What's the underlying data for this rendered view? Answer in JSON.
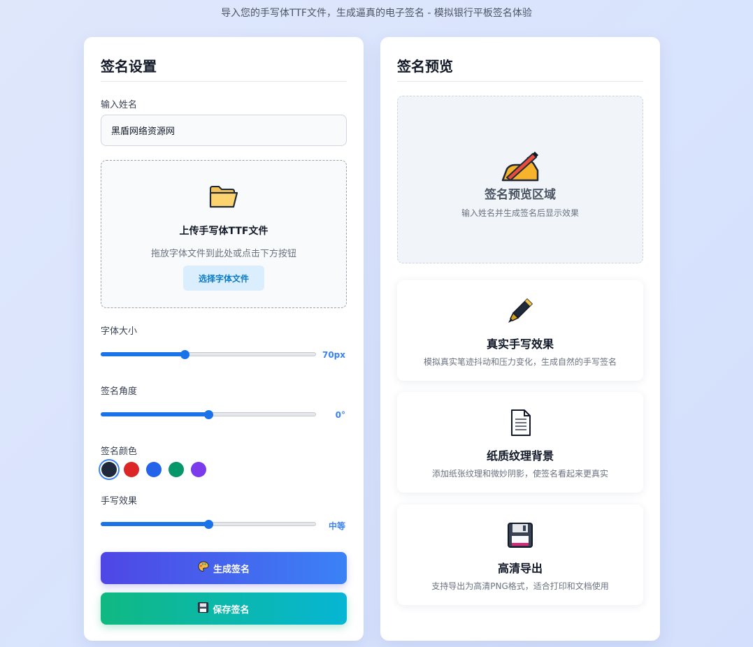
{
  "header": {
    "subtitle": "导入您的手写体TTF文件，生成逼真的电子签名 - 模拟银行平板签名体验"
  },
  "settings": {
    "title": "签名设置",
    "name_label": "输入姓名",
    "name_value": "黑盾网络资源网",
    "upload": {
      "title": "上传手写体TTF文件",
      "hint": "拖放字体文件到此处或点击下方按钮",
      "button": "选择字体文件"
    },
    "font_size": {
      "label": "字体大小",
      "value_text": "70px",
      "level": 0.39
    },
    "angle": {
      "label": "签名角度",
      "value_text": "0°",
      "level": 0.5
    },
    "color": {
      "label": "签名颜色",
      "options": [
        "#1e293b",
        "#dc2626",
        "#2563eb",
        "#059669",
        "#7c3aed"
      ],
      "selected_index": 0
    },
    "effect": {
      "label": "手写效果",
      "value_text": "中等",
      "level": 0.5
    },
    "generate_button": "生成签名",
    "save_button": "保存签名"
  },
  "preview": {
    "title": "签名预览",
    "area_title": "签名预览区域",
    "area_hint": "输入姓名并生成签名后显示效果",
    "features": [
      {
        "icon": "fountain-pen-icon",
        "title": "真实手写效果",
        "desc": "模拟真实笔迹抖动和压力变化，生成自然的手写签名"
      },
      {
        "icon": "document-icon",
        "title": "纸质纹理背景",
        "desc": "添加纸张纹理和微妙阴影，使签名看起来更真实"
      },
      {
        "icon": "floppy-disk-icon",
        "title": "高清导出",
        "desc": "支持导出为高清PNG格式，适合打印和文档使用"
      }
    ]
  },
  "colors": {
    "accent": "#1a73e8",
    "generate_gradient": [
      "#4f46e5",
      "#3b82f6"
    ],
    "save_gradient": [
      "#10b981",
      "#06b6d4"
    ]
  }
}
